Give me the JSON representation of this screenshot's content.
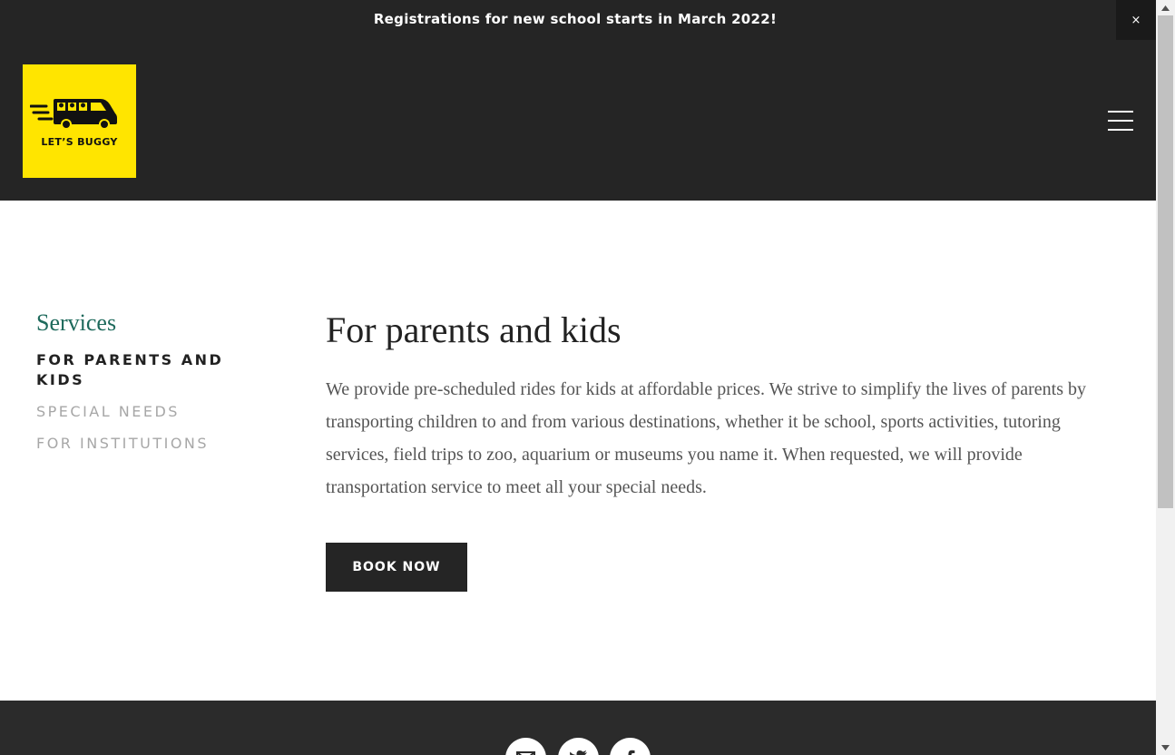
{
  "announcement": {
    "text": "Registrations for new school starts in March 2022!",
    "close_label": "×"
  },
  "header": {
    "logo_text": "LET’S BUGGY",
    "logo_icon": "bus-icon",
    "menu_icon": "hamburger-menu-icon"
  },
  "sidebar": {
    "title": "Services",
    "links": [
      {
        "label": "FOR PARENTS AND KIDS",
        "active": true
      },
      {
        "label": "SPECIAL NEEDS",
        "active": false
      },
      {
        "label": "FOR INSTITUTIONS",
        "active": false
      }
    ]
  },
  "main": {
    "heading": "For parents and kids",
    "body": "We provide pre-scheduled rides for kids at affordable prices. We strive to simplify the lives of parents by transporting children to and from various destinations, whether it be school, sports activities, tutoring services, field trips to zoo, aquarium or  museums you name it. When requested, we will provide transportation service to meet all your special needs.",
    "cta_label": "BOOK NOW"
  },
  "footer": {
    "social_icons": [
      "mail-icon",
      "twitter-icon",
      "facebook-icon"
    ]
  },
  "colors": {
    "header_bg": "#252525",
    "logo_bg": "#ffe500",
    "accent_green": "#1e6a5c",
    "inactive_gray": "#a7a7a7"
  }
}
